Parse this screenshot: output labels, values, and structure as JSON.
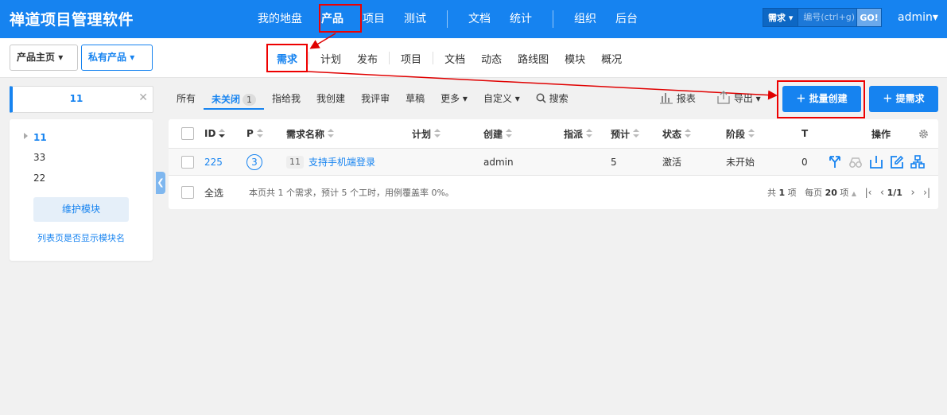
{
  "header": {
    "brand": "禅道项目管理软件",
    "nav": [
      {
        "label": "我的地盘"
      },
      {
        "label": "产品"
      },
      {
        "label": "项目"
      },
      {
        "label": "测试"
      },
      {
        "label": "文档"
      },
      {
        "label": "统计"
      },
      {
        "label": "组织"
      },
      {
        "label": "后台"
      }
    ],
    "search": {
      "type": "需求",
      "placeholder": "编号(ctrl+g)",
      "go": "GO!"
    },
    "user": "admin"
  },
  "subbar": {
    "product_home": "产品主页",
    "product": "私有产品",
    "nav": [
      {
        "label": "需求"
      },
      {
        "label": "计划"
      },
      {
        "label": "发布"
      },
      {
        "label": "项目"
      },
      {
        "label": "文档"
      },
      {
        "label": "动态"
      },
      {
        "label": "路线图"
      },
      {
        "label": "模块"
      },
      {
        "label": "概况"
      }
    ]
  },
  "sidebar": {
    "search_value": "11",
    "modules": [
      {
        "label": "11"
      },
      {
        "label": "33"
      },
      {
        "label": "22"
      }
    ],
    "maintain_button": "维护模块",
    "show_module_link": "列表页是否显示模块名"
  },
  "filters": {
    "all": "所有",
    "unclosed": "未关闭",
    "unclosed_count": "1",
    "assigned_to_me": "指给我",
    "created_by_me": "我创建",
    "reviewed_by_me": "我评审",
    "draft": "草稿",
    "more": "更多",
    "custom": "自定义",
    "search": "搜索",
    "report": "报表",
    "export": "导出",
    "batch_create": "批量创建",
    "create": "提需求"
  },
  "table": {
    "columns": {
      "id": "ID",
      "pri": "P",
      "title": "需求名称",
      "plan": "计划",
      "opened_by": "创建",
      "assigned_to": "指派",
      "estimate": "预计",
      "status": "状态",
      "stage": "阶段",
      "tasks": "T",
      "actions": "操作"
    },
    "rows": [
      {
        "id": "225",
        "pri": "3",
        "module": "11",
        "title": "支持手机端登录",
        "plan": "",
        "opened_by": "admin",
        "assigned_to": "",
        "estimate": "5",
        "status": "激活",
        "stage": "未开始",
        "tasks": "0"
      }
    ],
    "footer": {
      "select_all": "全选",
      "summary": "本页共 1 个需求，预计 5 个工时，用例覆盖率 0%。",
      "total_label": "共",
      "total": "1",
      "total_unit": "项",
      "per_page_label": "每页",
      "per_page": "20",
      "per_page_unit": "项",
      "page": "1/1"
    }
  },
  "colors": {
    "primary": "#1683f0",
    "highlight": "#e00000"
  }
}
